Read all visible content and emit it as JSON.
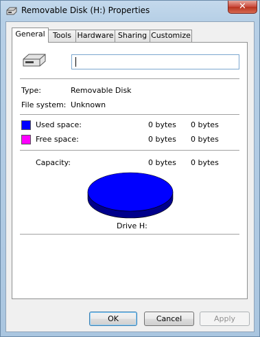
{
  "window": {
    "title": "Removable Disk (H:) Properties",
    "close_label": "✕"
  },
  "tabs": [
    {
      "label": "General"
    },
    {
      "label": "Tools"
    },
    {
      "label": "Hardware"
    },
    {
      "label": "Sharing"
    },
    {
      "label": "Customize"
    }
  ],
  "general": {
    "name_value": "",
    "type_label": "Type:",
    "type_value": "Removable Disk",
    "fs_label": "File system:",
    "fs_value": "Unknown",
    "used_label": "Used space:",
    "used_bytes": "0 bytes",
    "used_size": "0 bytes",
    "free_label": "Free space:",
    "free_bytes": "0 bytes",
    "free_size": "0 bytes",
    "capacity_label": "Capacity:",
    "capacity_bytes": "0 bytes",
    "capacity_size": "0 bytes",
    "drive_label": "Drive H:"
  },
  "colors": {
    "used": "#0000ff",
    "free": "#ff00ff",
    "pie_side": "#00008b"
  },
  "buttons": {
    "ok": "OK",
    "cancel": "Cancel",
    "apply": "Apply"
  }
}
